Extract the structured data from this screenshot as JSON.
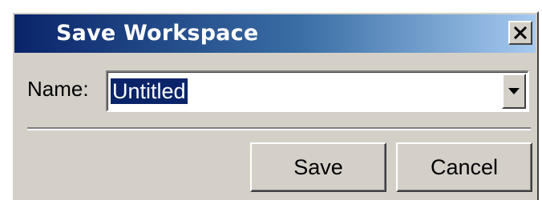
{
  "dialog": {
    "title": "Save Workspace",
    "close_icon": "close-icon"
  },
  "form": {
    "name_label": "Name:",
    "name_value": "Untitled",
    "dropdown_icon": "chevron-down-icon"
  },
  "buttons": {
    "save_label": "Save",
    "cancel_label": "Cancel"
  },
  "colors": {
    "titlebar_start": "#0a246a",
    "titlebar_end": "#a6caf0",
    "dialog_face": "#d4d0c8",
    "selection": "#0a246a"
  }
}
